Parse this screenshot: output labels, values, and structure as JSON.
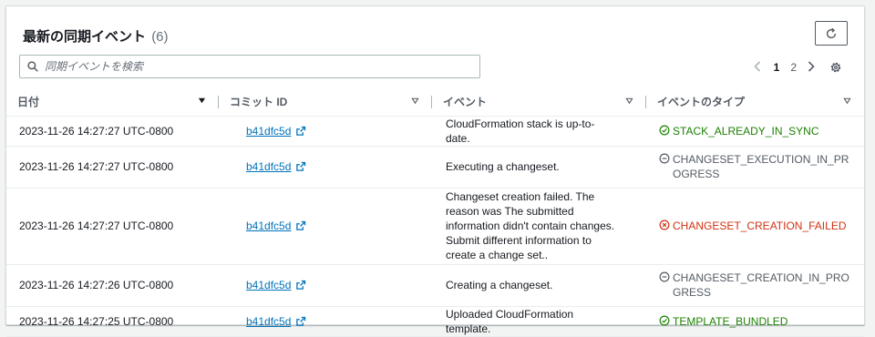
{
  "panel": {
    "title": "最新の同期イベント",
    "count": "(6)"
  },
  "search": {
    "placeholder": "同期イベントを検索"
  },
  "pagination": {
    "pages": [
      "1",
      "2"
    ],
    "current_page": "1"
  },
  "table": {
    "columns": [
      "日付",
      "コミット ID",
      "イベント",
      "イベントのタイプ"
    ],
    "rows": [
      {
        "date": "2023-11-26 14:27:27 UTC-0800",
        "commit": "b41dfc5d",
        "event": "CloudFormation stack is up-to-date.",
        "type": "STACK_ALREADY_IN_SYNC",
        "status": "success"
      },
      {
        "date": "2023-11-26 14:27:27 UTC-0800",
        "commit": "b41dfc5d",
        "event": "Executing a changeset.",
        "type": "CHANGESET_EXECUTION_IN_PROGRESS",
        "status": "pending"
      },
      {
        "date": "2023-11-26 14:27:27 UTC-0800",
        "commit": "b41dfc5d",
        "event": "Changeset creation failed. The reason was The submitted information didn't contain changes. Submit different information to create a change set..",
        "type": "CHANGESET_CREATION_FAILED",
        "status": "error"
      },
      {
        "date": "2023-11-26 14:27:26 UTC-0800",
        "commit": "b41dfc5d",
        "event": "Creating a changeset.",
        "type": "CHANGESET_CREATION_IN_PROGRESS",
        "status": "pending"
      },
      {
        "date": "2023-11-26 14:27:25 UTC-0800",
        "commit": "b41dfc5d",
        "event": "Uploaded CloudFormation template.",
        "type": "TEMPLATE_BUNDLED",
        "status": "success"
      }
    ]
  },
  "colors": {
    "link": "#0073bb",
    "success": "#1d8102",
    "pending": "#545b64",
    "error": "#d13212"
  },
  "icons": {
    "refresh": "refresh-icon",
    "search": "search-icon",
    "settings": "gear-icon",
    "external": "external-link-icon",
    "success": "check-circle-icon",
    "pending": "pending-circle-icon",
    "error": "error-circle-icon"
  }
}
